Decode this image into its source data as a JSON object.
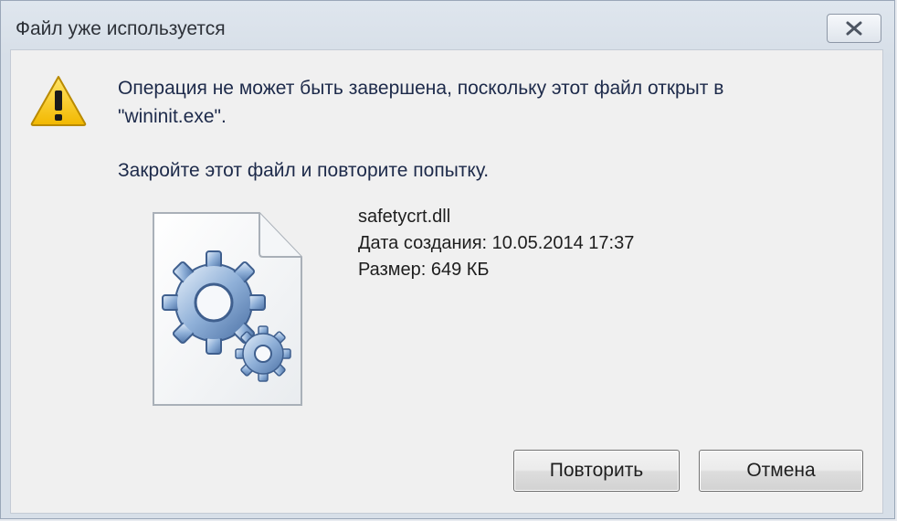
{
  "dialog": {
    "title": "Файл уже используется",
    "close_icon": "close-icon"
  },
  "message": {
    "icon": "warning-icon",
    "line1": "Операция не может быть завершена, поскольку этот файл открыт в",
    "line1b": "\"wininit.exe\".",
    "line2": "Закройте этот файл и повторите попытку."
  },
  "file": {
    "icon": "system-file-gears-icon",
    "name": "safetycrt.dll",
    "created": "Дата создания: 10.05.2014 17:37",
    "size": "Размер: 649 КБ"
  },
  "buttons": {
    "retry_label": "Повторить",
    "cancel_label": "Отмена"
  },
  "colors": {
    "warning": "#f5c400",
    "message_text": "#1d2a4a",
    "client_bg": "#f0f0f0"
  }
}
